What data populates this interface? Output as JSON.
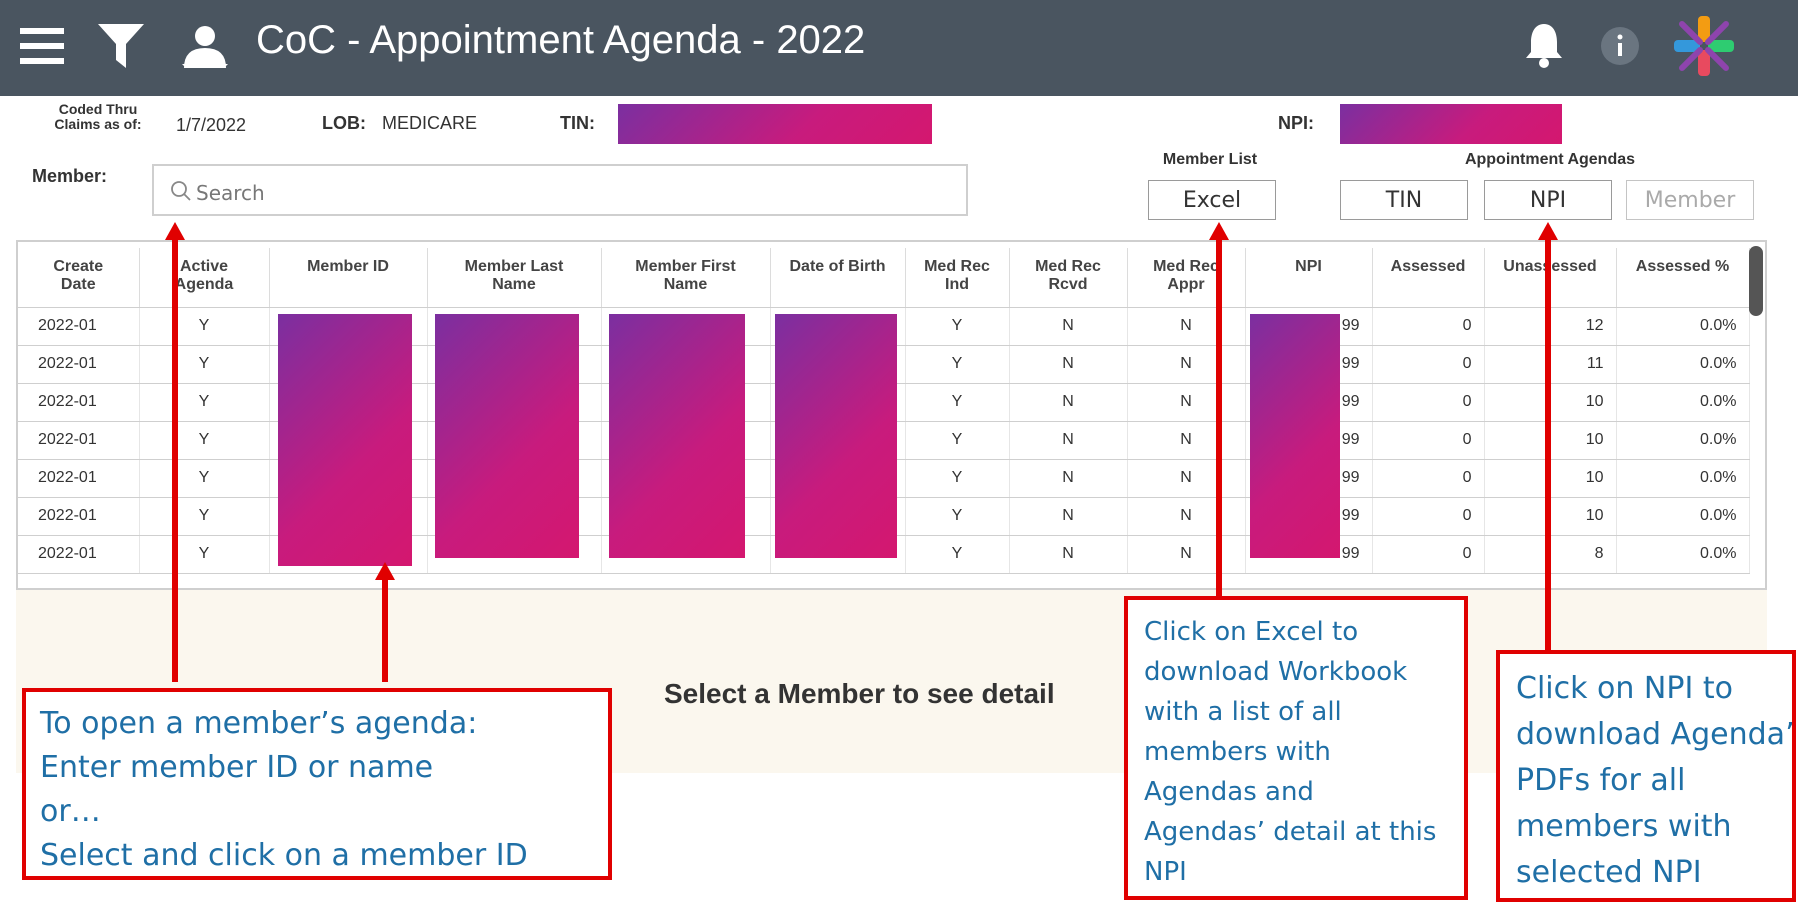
{
  "header": {
    "title": "CoC - Appointment Agenda - 2022",
    "menu_icon": "hamburger-menu-icon",
    "filter_icon": "filter-icon",
    "user_icon": "user-icon",
    "bell_icon": "bell-icon",
    "info_icon": "info-icon",
    "logo": "colorful-x-logo"
  },
  "filters": {
    "coded_thru_label_1": "Coded Thru",
    "coded_thru_label_2": "Claims as of:",
    "coded_thru_value": "1/7/2022",
    "lob_label": "LOB:",
    "lob_value": "MEDICARE",
    "tin_label": "TIN:",
    "npi_label": "NPI:",
    "member_label": "Member:",
    "search_placeholder": "Search"
  },
  "buttons": {
    "member_list_label": "Member List",
    "excel": "Excel",
    "appointment_agendas_label": "Appointment Agendas",
    "tin": "TIN",
    "npi": "NPI",
    "member": "Member"
  },
  "table": {
    "columns": [
      [
        "Create",
        "Date"
      ],
      [
        "Active",
        "Agenda"
      ],
      [
        "Member ID",
        ""
      ],
      [
        "Member Last",
        "Name"
      ],
      [
        "Member First",
        "Name"
      ],
      [
        "Date of Birth",
        ""
      ],
      [
        "Med Rec",
        "Ind"
      ],
      [
        "Med Rec",
        "Rcvd"
      ],
      [
        "Med Rec",
        "Appr"
      ],
      [
        "NPI",
        ""
      ],
      [
        "Assessed",
        ""
      ],
      [
        "Unassessed",
        ""
      ],
      [
        "Assessed %",
        ""
      ]
    ],
    "rows": [
      {
        "create": "2022-01",
        "active": "Y",
        "ind": "Y",
        "rcvd": "N",
        "appr": "N",
        "npi_tail": "99",
        "assessed": "0",
        "unassessed": "12",
        "pct": "0.0%"
      },
      {
        "create": "2022-01",
        "active": "Y",
        "ind": "Y",
        "rcvd": "N",
        "appr": "N",
        "npi_tail": "99",
        "assessed": "0",
        "unassessed": "11",
        "pct": "0.0%"
      },
      {
        "create": "2022-01",
        "active": "Y",
        "ind": "Y",
        "rcvd": "N",
        "appr": "N",
        "npi_tail": "99",
        "assessed": "0",
        "unassessed": "10",
        "pct": "0.0%"
      },
      {
        "create": "2022-01",
        "active": "Y",
        "ind": "Y",
        "rcvd": "N",
        "appr": "N",
        "npi_tail": "99",
        "assessed": "0",
        "unassessed": "10",
        "pct": "0.0%"
      },
      {
        "create": "2022-01",
        "active": "Y",
        "ind": "Y",
        "rcvd": "N",
        "appr": "N",
        "npi_tail": "99",
        "assessed": "0",
        "unassessed": "10",
        "pct": "0.0%"
      },
      {
        "create": "2022-01",
        "active": "Y",
        "ind": "Y",
        "rcvd": "N",
        "appr": "N",
        "npi_tail": "99",
        "assessed": "0",
        "unassessed": "10",
        "pct": "0.0%"
      },
      {
        "create": "2022-01",
        "active": "Y",
        "ind": "Y",
        "rcvd": "N",
        "appr": "N",
        "npi_tail": "99",
        "assessed": "0",
        "unassessed": "8",
        "pct": "0.0%"
      }
    ]
  },
  "detail": {
    "message": "Select a Member to see detail"
  },
  "callouts": {
    "member": [
      "To open a member’s agenda:",
      "Enter member ID or name",
      "or…",
      "Select and click on a member ID"
    ],
    "excel": [
      "Click on Excel to",
      "download Workbook",
      "with a list of all",
      "members with",
      "Agendas and",
      "Agendas’ detail at this",
      "NPI"
    ],
    "npi": [
      "Click on NPI to",
      "download Agenda’s",
      "PDFs for all",
      "members with",
      "selected NPI"
    ]
  },
  "colors": {
    "header_bg": "#4a5560",
    "callout_border": "#e00000",
    "callout_text": "#1f6fa6",
    "detail_bg": "#fbf7ee"
  }
}
